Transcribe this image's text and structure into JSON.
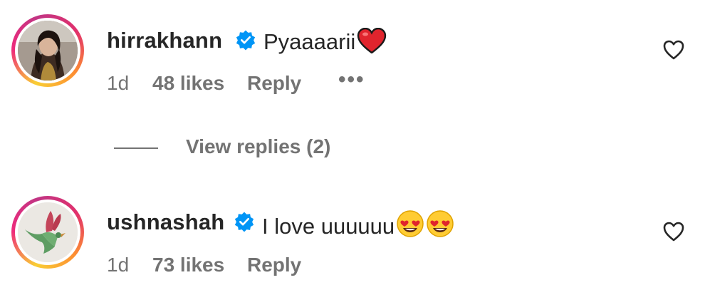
{
  "comments": [
    {
      "username": "hirrakhann",
      "verified": true,
      "text": "Pyaaaarii",
      "emoji": "red-heart",
      "time": "1d",
      "likes": "48 likes",
      "reply_label": "Reply",
      "more_label": "•••",
      "view_replies": "View replies (2)"
    },
    {
      "username": "ushnashah",
      "verified": true,
      "text": "I love uuuuuu",
      "emoji": "heart-eyes x2",
      "time": "1d",
      "likes": "73 likes",
      "reply_label": "Reply"
    }
  ],
  "colors": {
    "text": "#262626",
    "secondary": "#737373",
    "verified_blue": "#0095f6"
  }
}
